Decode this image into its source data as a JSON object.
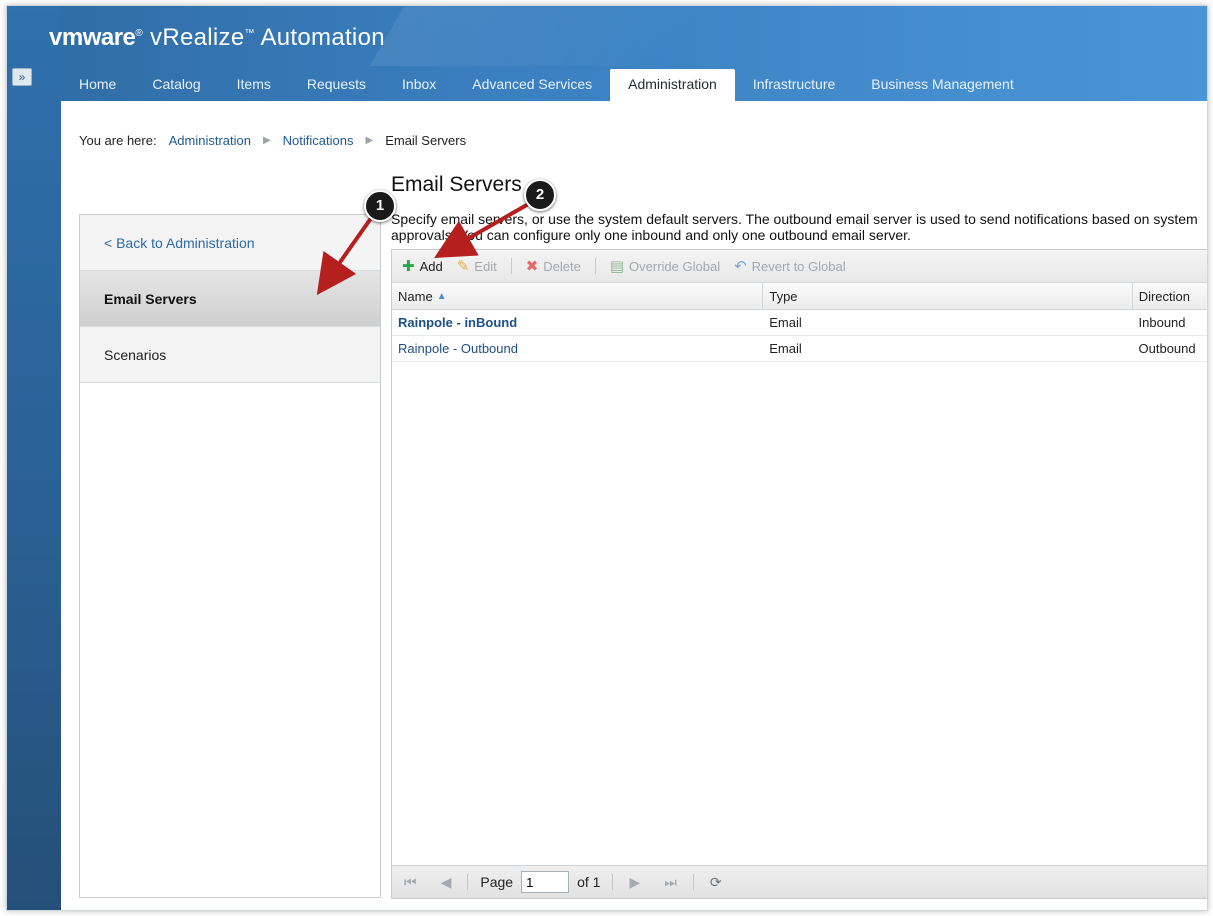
{
  "header": {
    "brand": "vmware",
    "product": "vRealize",
    "product_suffix": "Automation",
    "expand_icon": "»"
  },
  "nav": {
    "tabs": [
      {
        "label": "Home"
      },
      {
        "label": "Catalog"
      },
      {
        "label": "Items"
      },
      {
        "label": "Requests"
      },
      {
        "label": "Inbox"
      },
      {
        "label": "Advanced Services"
      },
      {
        "label": "Administration",
        "active": true
      },
      {
        "label": "Infrastructure"
      },
      {
        "label": "Business Management"
      }
    ]
  },
  "breadcrumb": {
    "prefix": "You are here:",
    "items": [
      "Administration",
      "Notifications"
    ],
    "current": "Email Servers"
  },
  "sidebar": {
    "back_label": "< Back to Administration",
    "items": [
      {
        "label": "Email Servers",
        "active": true
      },
      {
        "label": "Scenarios"
      }
    ]
  },
  "main": {
    "title": "Email Servers",
    "description_line1": "Specify email servers, or use the system default servers. The outbound email server is used to send notifications based on system",
    "description_line2": "approvals. You can configure only one inbound and only one outbound email server."
  },
  "toolbar": {
    "add": "Add",
    "edit": "Edit",
    "delete": "Delete",
    "override": "Override Global",
    "revert": "Revert to Global"
  },
  "table": {
    "columns": [
      "Name",
      "Type",
      "Direction"
    ],
    "rows": [
      {
        "name": "Rainpole - inBound",
        "type": "Email",
        "direction": "Inbound"
      },
      {
        "name": "Rainpole - Outbound",
        "type": "Email",
        "direction": "Outbound"
      }
    ]
  },
  "pager": {
    "page_label": "Page",
    "page_value": "1",
    "of_label": "of 1"
  },
  "callouts": [
    "1",
    "2"
  ],
  "colors": {
    "header_blue": "#3a7fc0",
    "link_blue": "#1e5a96",
    "annotation_arrow": "#b5201f"
  }
}
